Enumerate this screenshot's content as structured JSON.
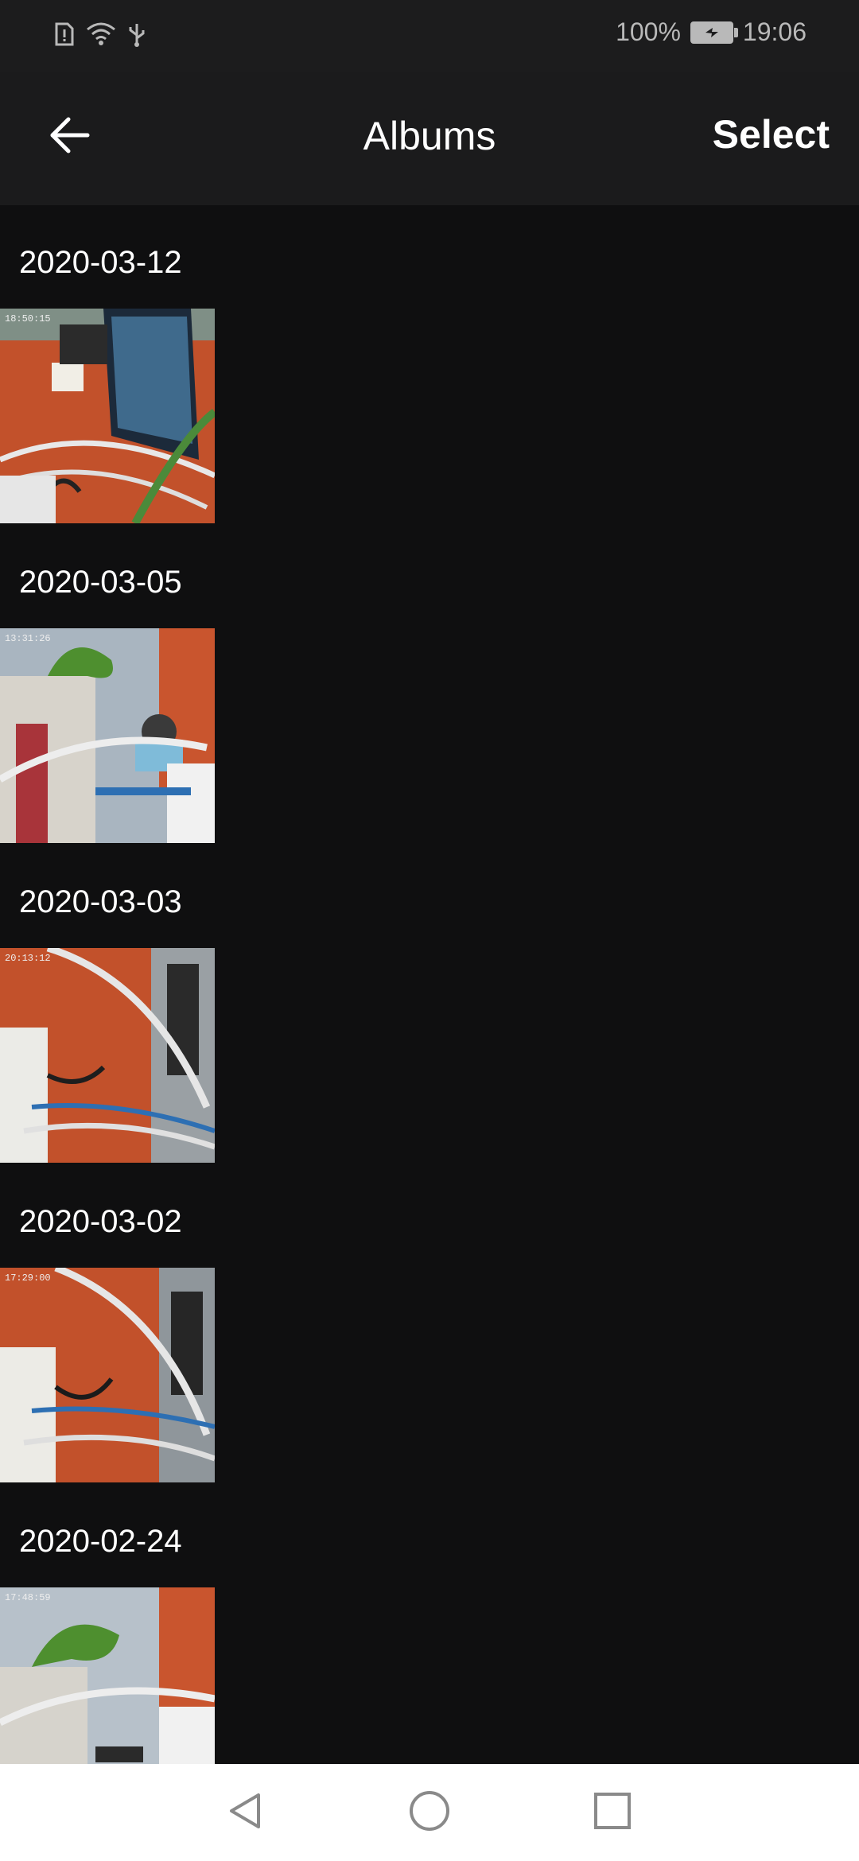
{
  "status_bar": {
    "battery_percent": "100%",
    "time": "19:06",
    "icons": [
      "sim-alert-icon",
      "wifi-icon",
      "usb-icon",
      "battery-charging-icon"
    ]
  },
  "app_bar": {
    "title": "Albums",
    "select_label": "Select",
    "back_icon": "arrow-left-icon"
  },
  "albums": [
    {
      "date": "2020-03-12",
      "thumb_time": "18:50:15"
    },
    {
      "date": "2020-03-05",
      "thumb_time": "13:31:26"
    },
    {
      "date": "2020-03-03",
      "thumb_time": "20:13:12"
    },
    {
      "date": "2020-03-02",
      "thumb_time": "17:29:00"
    },
    {
      "date": "2020-02-24",
      "thumb_time": "17:48:59"
    }
  ],
  "nav_bar": {
    "icons": [
      "back-triangle-icon",
      "home-circle-icon",
      "recents-square-icon"
    ]
  },
  "colors": {
    "background": "#0f0f10",
    "app_bar": "#1b1b1c",
    "status_bar": "#1c1c1d",
    "nav_bar": "#ffffff"
  }
}
